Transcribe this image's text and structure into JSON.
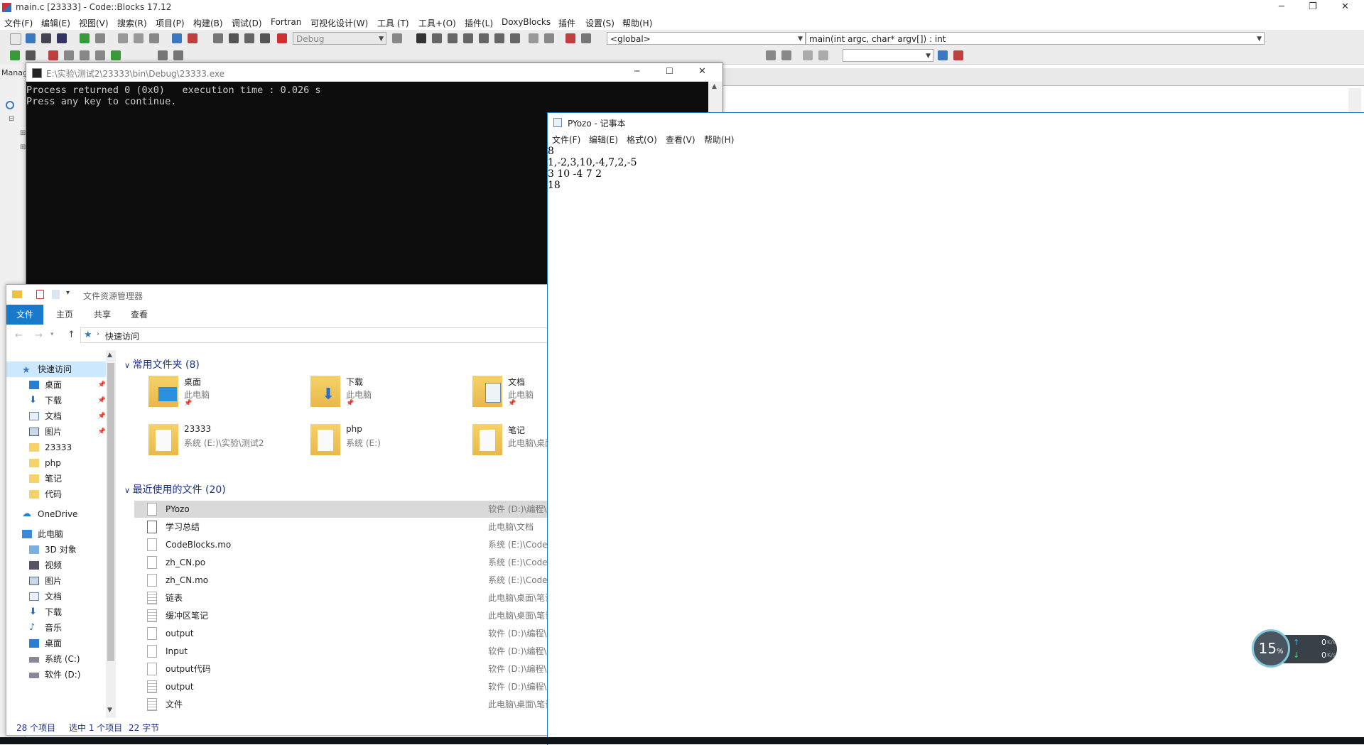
{
  "codeblocks": {
    "title": "main.c [23333] - Code::Blocks 17.12",
    "menu": [
      "文件(F)",
      "编辑(E)",
      "视图(V)",
      "搜索(R)",
      "项目(P)",
      "构建(B)",
      "调试(D)",
      "Fortran",
      "可视化设计(W)",
      "工具 (T)",
      "工具+(O)",
      "插件(L)",
      "DoxyBlocks",
      "插件",
      "设置(S)",
      "帮助(H)"
    ],
    "build_target": "Debug",
    "scope": "<global>",
    "function": "main(int argc, char* argv[]) : int",
    "left_panel_label": "Manag"
  },
  "console": {
    "title": "E:\\实验\\测试2\\23333\\bin\\Debug\\23333.exe",
    "lines": [
      "Process returned 0 (0x0)   execution time : 0.026 s",
      "Press any key to continue."
    ]
  },
  "explorer": {
    "title": "文件资源管理器",
    "ribbon_tabs": [
      "文件",
      "主页",
      "共享",
      "查看"
    ],
    "address": "快速访问",
    "nav": [
      {
        "label": "快速访问"
      },
      {
        "label": "桌面"
      },
      {
        "label": "下载"
      },
      {
        "label": "文档"
      },
      {
        "label": "图片"
      },
      {
        "label": "23333"
      },
      {
        "label": "php"
      },
      {
        "label": "笔记"
      },
      {
        "label": "代码"
      },
      {
        "label": "OneDrive"
      },
      {
        "label": "此电脑"
      },
      {
        "label": "3D 对象"
      },
      {
        "label": "视频"
      },
      {
        "label": "图片"
      },
      {
        "label": "文档"
      },
      {
        "label": "下载"
      },
      {
        "label": "音乐"
      },
      {
        "label": "桌面"
      },
      {
        "label": "系统 (C:)"
      },
      {
        "label": "软件 (D:)"
      }
    ],
    "frequent_header": "常用文件夹 (8)",
    "frequent": [
      {
        "name": "桌面",
        "sub": "此电脑"
      },
      {
        "name": "下载",
        "sub": "此电脑"
      },
      {
        "name": "文档",
        "sub": "此电脑"
      },
      {
        "name": "23333",
        "sub": "系统 (E:)\\实验\\测试2"
      },
      {
        "name": "php",
        "sub": "系统 (E:)"
      },
      {
        "name": "笔记",
        "sub": "此电脑\\桌面"
      }
    ],
    "recent_header": "最近使用的文件 (20)",
    "recent": [
      {
        "name": "PYozo",
        "loc": "软件 (D:)\\编程\\C"
      },
      {
        "name": "学习总结",
        "loc": "此电脑\\文档"
      },
      {
        "name": "CodeBlocks.mo",
        "loc": "系统 (E:)\\CodeB"
      },
      {
        "name": "zh_CN.po",
        "loc": "系统 (E:)\\CodeB"
      },
      {
        "name": "zh_CN.mo",
        "loc": "系统 (E:)\\CodeB"
      },
      {
        "name": "链表",
        "loc": "此电脑\\桌面\\笔记"
      },
      {
        "name": "缓冲区笔记",
        "loc": "此电脑\\桌面\\笔记"
      },
      {
        "name": "output",
        "loc": "软件 (D:)\\编程\\C"
      },
      {
        "name": "Input",
        "loc": "软件 (D:)\\编程\\C"
      },
      {
        "name": "output代码",
        "loc": "软件 (D:)\\编程\\C"
      },
      {
        "name": "output",
        "loc": "软件 (D:)\\编程\\C"
      },
      {
        "name": "文件",
        "loc": "此电脑\\桌面\\笔记"
      }
    ],
    "status": {
      "count": "28 个项目",
      "selected": "选中 1 个项目",
      "size": "22 字节"
    }
  },
  "notepad": {
    "title": "PYozo - 记事本",
    "menu": [
      "文件(F)",
      "编辑(E)",
      "格式(O)",
      "查看(V)",
      "帮助(H)"
    ],
    "lines": [
      "8",
      "1,-2,3,10,-4,7,2,-5",
      "3 10 -4 7 2",
      "18"
    ]
  },
  "netmeter": {
    "percent": "15",
    "percent_unit": "%",
    "up": "0",
    "down": "0",
    "unit": "K/s"
  }
}
